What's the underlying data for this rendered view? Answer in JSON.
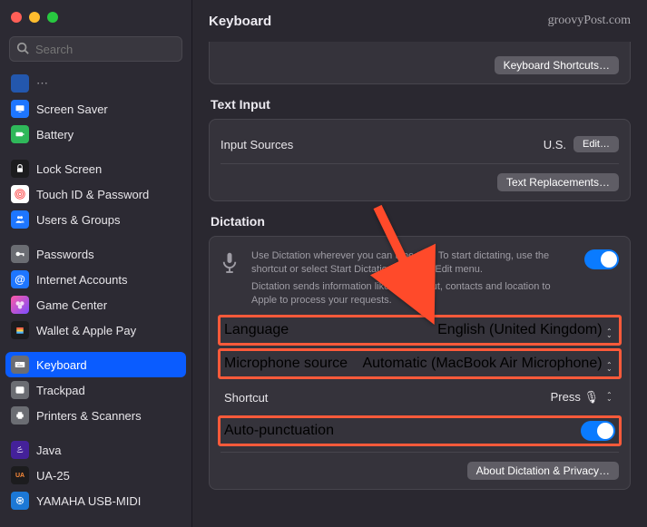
{
  "window": {
    "title": "Keyboard"
  },
  "watermark": "groovyPost.com",
  "search": {
    "placeholder": "Search"
  },
  "sidebar": {
    "items": [
      {
        "label": "Screen Saver",
        "icon": "screensaver",
        "color": "ic-blue"
      },
      {
        "label": "Battery",
        "icon": "battery",
        "color": "ic-green"
      },
      {
        "label": "Lock Screen",
        "icon": "lock",
        "color": "ic-dark"
      },
      {
        "label": "Touch ID & Password",
        "icon": "touchid",
        "color": "ic-red"
      },
      {
        "label": "Users & Groups",
        "icon": "users",
        "color": "ic-blue"
      },
      {
        "label": "Passwords",
        "icon": "key",
        "color": "ic-gray"
      },
      {
        "label": "Internet Accounts",
        "icon": "at",
        "color": "ic-blue"
      },
      {
        "label": "Game Center",
        "icon": "gamecenter",
        "color": "ic-gc"
      },
      {
        "label": "Wallet & Apple Pay",
        "icon": "wallet",
        "color": "ic-dark"
      },
      {
        "label": "Keyboard",
        "icon": "keyboard",
        "color": "ic-gray",
        "selected": true
      },
      {
        "label": "Trackpad",
        "icon": "trackpad",
        "color": "ic-gray"
      },
      {
        "label": "Printers & Scanners",
        "icon": "printer",
        "color": "ic-gray"
      },
      {
        "label": "Java",
        "icon": "java",
        "color": "ic-purple"
      },
      {
        "label": "UA-25",
        "icon": "ua25",
        "color": "ic-dark"
      },
      {
        "label": "YAMAHA USB-MIDI",
        "icon": "yamaha",
        "color": "ic-yamaha"
      }
    ]
  },
  "top_card": {
    "keyboard_shortcuts_btn": "Keyboard Shortcuts…"
  },
  "text_input": {
    "title": "Text Input",
    "input_sources_label": "Input Sources",
    "input_sources_value": "U.S.",
    "edit_btn": "Edit…",
    "text_replacements_btn": "Text Replacements…"
  },
  "dictation": {
    "title": "Dictation",
    "desc1": "Use Dictation wherever you can type text. To start dictating, use the shortcut or select Start Dictation from the Edit menu.",
    "desc2": "Dictation sends information like voice input, contacts and location to Apple to process your requests.",
    "enabled": true,
    "language_label": "Language",
    "language_value": "English (United Kingdom)",
    "mic_label": "Microphone source",
    "mic_value": "Automatic (MacBook Air Microphone)",
    "shortcut_label": "Shortcut",
    "shortcut_value": "Press 🎙︎",
    "autopunct_label": "Auto-punctuation",
    "autopunct_enabled": true,
    "about_btn": "About Dictation & Privacy…"
  }
}
